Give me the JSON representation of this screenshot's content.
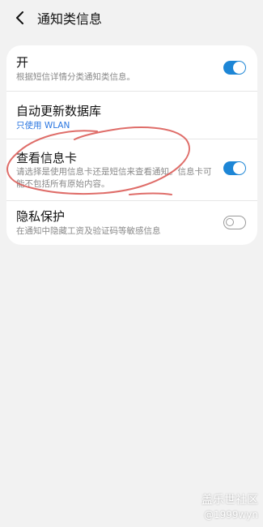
{
  "header": {
    "title": "通知类信息",
    "back_icon": "back-arrow-icon"
  },
  "settings": [
    {
      "title": "开",
      "subtitle": "根据短信详情分类通知类信息。",
      "toggle": "on"
    },
    {
      "title": "自动更新数据库",
      "subtitle": "只使用 WLAN",
      "subtitle_color": "#2a76e0"
    },
    {
      "title": "查看信息卡",
      "subtitle": "请选择是使用信息卡还是短信来查看通知。信息卡可能不包括所有原始内容。",
      "toggle": "on"
    },
    {
      "title": "隐私保护",
      "subtitle": "在通知中隐藏工资及验证码等敏感信息",
      "toggle": "off"
    }
  ],
  "watermark": {
    "line1": "盖乐世社区",
    "line2": "@1999wyn"
  },
  "colors": {
    "toggle_on": "#1d86d6",
    "annotation": "#d9534f"
  }
}
